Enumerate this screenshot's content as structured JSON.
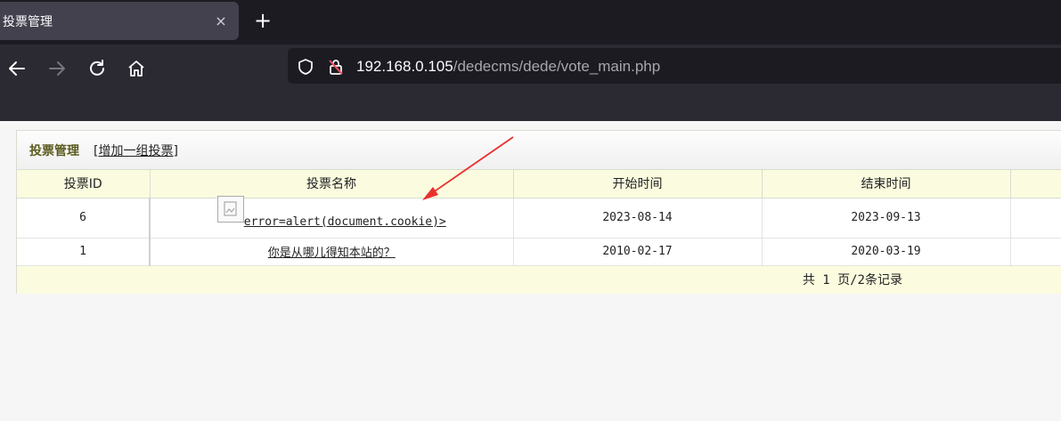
{
  "browser": {
    "tab_title": "投票管理",
    "tab_close": "×",
    "new_tab": "+",
    "url_host": "192.168.0.105",
    "url_path": "/dedecms/dede/vote_main.php"
  },
  "panel": {
    "title": "投票管理",
    "bracket_open": "[",
    "add_link": "增加一组投票",
    "bracket_close": "]"
  },
  "table": {
    "headers": [
      "投票ID",
      "投票名称",
      "开始时间",
      "结束时间"
    ],
    "rows": [
      {
        "id": "6",
        "name": "error=alert(document.cookie)>",
        "start": "2023-08-14",
        "end": "2023-09-13"
      },
      {
        "id": "1",
        "name": "你是从哪儿得知本站的？",
        "start": "2010-02-17",
        "end": "2020-03-19"
      }
    ],
    "footer": "共 1 页/2条记录"
  },
  "colors": {
    "header_bg": "#fbfcdf",
    "title_color": "#5b5a1e",
    "annotation_arrow": "#e8312f"
  }
}
